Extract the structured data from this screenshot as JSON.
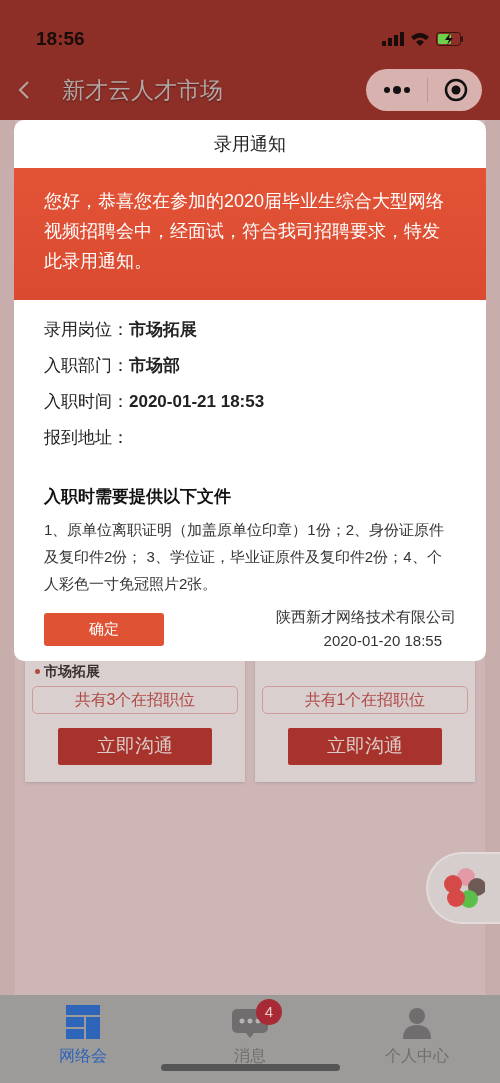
{
  "status_bar": {
    "time": "18:56"
  },
  "nav": {
    "title": "新才云人才市场"
  },
  "modal": {
    "title": "录用通知",
    "message": "您好，恭喜您在参加的2020届毕业生综合大型网络视频招聘会中，经面试，符合我司招聘要求，特发此录用通知。",
    "fields": [
      {
        "label": "录用岗位：",
        "value": "市场拓展"
      },
      {
        "label": "入职部门：",
        "value": "市场部"
      },
      {
        "label": "入职时间：",
        "value": "2020-01-21 18:53"
      },
      {
        "label": "报到地址："
      }
    ],
    "documents_title": "入职时需要提供以下文件",
    "documents_text": "1、原单位离职证明（加盖原单位印章）1份；2、身份证原件及复印件2份； 3、学位证，毕业证原件及复印件2份；4、个人彩色一寸免冠照片2张。",
    "confirm_button": "确定",
    "company": "陕西新才网络技术有限公司",
    "date": "2020-01-20 18:55"
  },
  "cards": [
    {
      "position": "市场拓展",
      "openings": "共有3个在招职位",
      "button": "立即沟通"
    },
    {
      "openings": "共有1个在招职位",
      "button": "立即沟通"
    }
  ],
  "tab_bar": [
    {
      "label": "网络会",
      "selected": true
    },
    {
      "label": "消息",
      "selected": false,
      "badge": "4"
    },
    {
      "label": "个人中心",
      "selected": false
    }
  ]
}
